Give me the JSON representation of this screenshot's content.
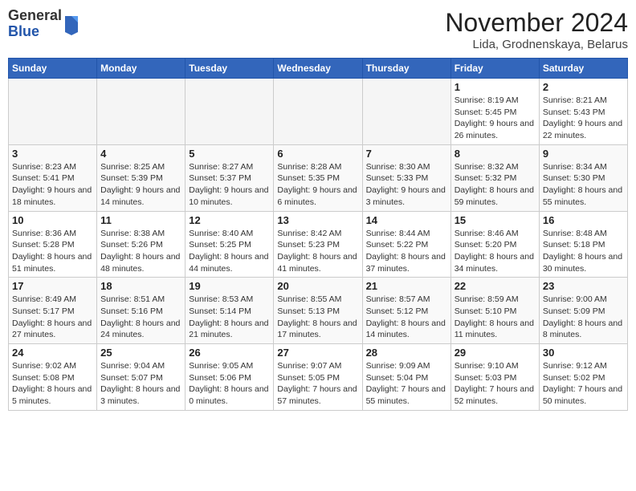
{
  "logo": {
    "general": "General",
    "blue": "Blue"
  },
  "header": {
    "title": "November 2024",
    "subtitle": "Lida, Grodnenskaya, Belarus"
  },
  "weekdays": [
    "Sunday",
    "Monday",
    "Tuesday",
    "Wednesday",
    "Thursday",
    "Friday",
    "Saturday"
  ],
  "weeks": [
    [
      {
        "day": "",
        "info": ""
      },
      {
        "day": "",
        "info": ""
      },
      {
        "day": "",
        "info": ""
      },
      {
        "day": "",
        "info": ""
      },
      {
        "day": "",
        "info": ""
      },
      {
        "day": "1",
        "info": "Sunrise: 8:19 AM\nSunset: 5:45 PM\nDaylight: 9 hours and 26 minutes."
      },
      {
        "day": "2",
        "info": "Sunrise: 8:21 AM\nSunset: 5:43 PM\nDaylight: 9 hours and 22 minutes."
      }
    ],
    [
      {
        "day": "3",
        "info": "Sunrise: 8:23 AM\nSunset: 5:41 PM\nDaylight: 9 hours and 18 minutes."
      },
      {
        "day": "4",
        "info": "Sunrise: 8:25 AM\nSunset: 5:39 PM\nDaylight: 9 hours and 14 minutes."
      },
      {
        "day": "5",
        "info": "Sunrise: 8:27 AM\nSunset: 5:37 PM\nDaylight: 9 hours and 10 minutes."
      },
      {
        "day": "6",
        "info": "Sunrise: 8:28 AM\nSunset: 5:35 PM\nDaylight: 9 hours and 6 minutes."
      },
      {
        "day": "7",
        "info": "Sunrise: 8:30 AM\nSunset: 5:33 PM\nDaylight: 9 hours and 3 minutes."
      },
      {
        "day": "8",
        "info": "Sunrise: 8:32 AM\nSunset: 5:32 PM\nDaylight: 8 hours and 59 minutes."
      },
      {
        "day": "9",
        "info": "Sunrise: 8:34 AM\nSunset: 5:30 PM\nDaylight: 8 hours and 55 minutes."
      }
    ],
    [
      {
        "day": "10",
        "info": "Sunrise: 8:36 AM\nSunset: 5:28 PM\nDaylight: 8 hours and 51 minutes."
      },
      {
        "day": "11",
        "info": "Sunrise: 8:38 AM\nSunset: 5:26 PM\nDaylight: 8 hours and 48 minutes."
      },
      {
        "day": "12",
        "info": "Sunrise: 8:40 AM\nSunset: 5:25 PM\nDaylight: 8 hours and 44 minutes."
      },
      {
        "day": "13",
        "info": "Sunrise: 8:42 AM\nSunset: 5:23 PM\nDaylight: 8 hours and 41 minutes."
      },
      {
        "day": "14",
        "info": "Sunrise: 8:44 AM\nSunset: 5:22 PM\nDaylight: 8 hours and 37 minutes."
      },
      {
        "day": "15",
        "info": "Sunrise: 8:46 AM\nSunset: 5:20 PM\nDaylight: 8 hours and 34 minutes."
      },
      {
        "day": "16",
        "info": "Sunrise: 8:48 AM\nSunset: 5:18 PM\nDaylight: 8 hours and 30 minutes."
      }
    ],
    [
      {
        "day": "17",
        "info": "Sunrise: 8:49 AM\nSunset: 5:17 PM\nDaylight: 8 hours and 27 minutes."
      },
      {
        "day": "18",
        "info": "Sunrise: 8:51 AM\nSunset: 5:16 PM\nDaylight: 8 hours and 24 minutes."
      },
      {
        "day": "19",
        "info": "Sunrise: 8:53 AM\nSunset: 5:14 PM\nDaylight: 8 hours and 21 minutes."
      },
      {
        "day": "20",
        "info": "Sunrise: 8:55 AM\nSunset: 5:13 PM\nDaylight: 8 hours and 17 minutes."
      },
      {
        "day": "21",
        "info": "Sunrise: 8:57 AM\nSunset: 5:12 PM\nDaylight: 8 hours and 14 minutes."
      },
      {
        "day": "22",
        "info": "Sunrise: 8:59 AM\nSunset: 5:10 PM\nDaylight: 8 hours and 11 minutes."
      },
      {
        "day": "23",
        "info": "Sunrise: 9:00 AM\nSunset: 5:09 PM\nDaylight: 8 hours and 8 minutes."
      }
    ],
    [
      {
        "day": "24",
        "info": "Sunrise: 9:02 AM\nSunset: 5:08 PM\nDaylight: 8 hours and 5 minutes."
      },
      {
        "day": "25",
        "info": "Sunrise: 9:04 AM\nSunset: 5:07 PM\nDaylight: 8 hours and 3 minutes."
      },
      {
        "day": "26",
        "info": "Sunrise: 9:05 AM\nSunset: 5:06 PM\nDaylight: 8 hours and 0 minutes."
      },
      {
        "day": "27",
        "info": "Sunrise: 9:07 AM\nSunset: 5:05 PM\nDaylight: 7 hours and 57 minutes."
      },
      {
        "day": "28",
        "info": "Sunrise: 9:09 AM\nSunset: 5:04 PM\nDaylight: 7 hours and 55 minutes."
      },
      {
        "day": "29",
        "info": "Sunrise: 9:10 AM\nSunset: 5:03 PM\nDaylight: 7 hours and 52 minutes."
      },
      {
        "day": "30",
        "info": "Sunrise: 9:12 AM\nSunset: 5:02 PM\nDaylight: 7 hours and 50 minutes."
      }
    ]
  ]
}
